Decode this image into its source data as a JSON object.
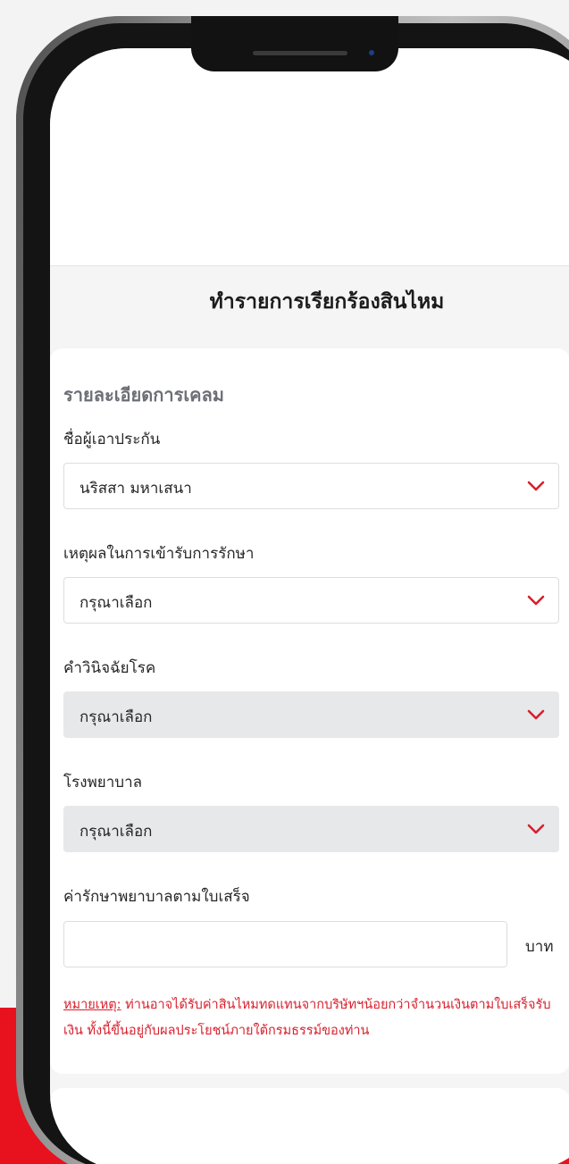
{
  "page_title": "ทำรายการเรียกร้องสินไหม",
  "section_title": "รายละเอียดการเคลม",
  "fields": [
    {
      "label": "ชื่อผู้เอาประกัน",
      "value": "นริสสา มหาเสนา",
      "disabled": false
    },
    {
      "label": "เหตุผลในการเข้ารับการรักษา",
      "value": "กรุณาเลือก",
      "disabled": false
    },
    {
      "label": "คำวินิจฉัยโรค",
      "value": "กรุณาเลือก",
      "disabled": true
    },
    {
      "label": "โรงพยาบาล",
      "value": "กรุณาเลือก",
      "disabled": true
    }
  ],
  "amount": {
    "label": "ค่ารักษาพยาบาลตามใบเสร็จ",
    "value": "",
    "unit": "บาท"
  },
  "note": {
    "title": "หมายเหตุ:",
    "text": " ท่านอาจได้รับค่าสินไหมทดแทนจากบริษัทฯน้อยกว่าจำนวนเงินตามใบเสร็จรับเงิน ทั้งนี้ขึ้นอยู่กับผลประโยชน์ภายใต้กรมธรรม์ของท่าน"
  },
  "icons": {
    "dropdown": "chevron-down-icon"
  },
  "colors": {
    "accent": "#e8121f",
    "chevron": "#d6202c",
    "note": "#d8202d",
    "section_title": "#6b6f76",
    "disabled_bg": "#e7e8ea"
  }
}
